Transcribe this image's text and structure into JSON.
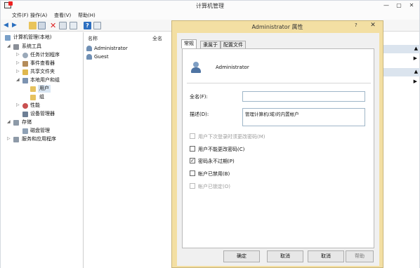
{
  "window": {
    "title": "计算机管理",
    "min": "—",
    "max": "▢",
    "close": "✕"
  },
  "menubar": [
    "文件(F)",
    "操作(A)",
    "查看(V)",
    "帮助(H)"
  ],
  "tree": {
    "root": "计算机管理(本地)",
    "system_tools": "系统工具",
    "task_scheduler": "任务计划程序",
    "event_viewer": "事件查看器",
    "shared_folders": "共享文件夹",
    "local_users_groups": "本地用户和组",
    "users": "用户",
    "groups": "组",
    "performance": "性能",
    "device_manager": "设备管理器",
    "storage": "存储",
    "disk_management": "磁盘管理",
    "services_apps": "服务和应用程序"
  },
  "list": {
    "col_name": "名称",
    "col_fullname": "全名",
    "rows": [
      "Administrator",
      "Guest"
    ]
  },
  "dialog": {
    "title": "Administrator 属性",
    "help": "?",
    "close": "✕",
    "tabs": [
      "常规",
      "隶属于",
      "配置文件"
    ],
    "user_name": "Administrator",
    "fullname_label": "全名(F):",
    "fullname_value": "",
    "desc_label": "描述(D):",
    "desc_value": "管理计算机(域)的内置帐户",
    "checkboxes": [
      {
        "label": "用户下次登录时须更改密码(M)",
        "checked": false,
        "disabled": true
      },
      {
        "label": "用户不能更改密码(C)",
        "checked": false,
        "disabled": false
      },
      {
        "label": "密码永不过期(P)",
        "checked": true,
        "disabled": false
      },
      {
        "label": "帐户已禁用(B)",
        "checked": false,
        "disabled": false
      },
      {
        "label": "帐户已锁定(O)",
        "checked": false,
        "disabled": true
      }
    ],
    "buttons": {
      "ok": "确定",
      "cancel": "取消",
      "apply": "取消",
      "help": "帮助"
    }
  },
  "colors": {
    "dialog_frame": "#f3dfa3",
    "actions_bar": "#dbe4ee",
    "toolbar": "#f6f6f6"
  }
}
